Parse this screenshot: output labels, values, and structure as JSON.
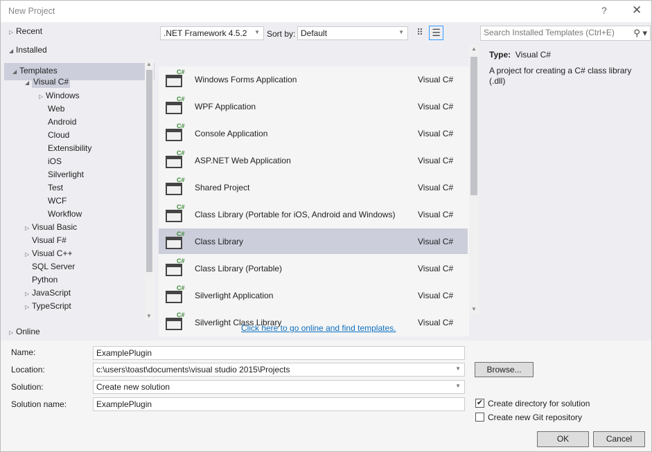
{
  "window": {
    "title": "New Project",
    "help": "?",
    "close": "✕"
  },
  "left": {
    "recent": "Recent",
    "installed": "Installed",
    "templates": "Templates",
    "visual_csharp": "Visual C#",
    "csharp_children": [
      "Windows",
      "Web",
      "Android",
      "Cloud",
      "Extensibility",
      "iOS",
      "Silverlight",
      "Test",
      "WCF",
      "Workflow"
    ],
    "languages": [
      {
        "label": "Visual Basic",
        "expandable": true
      },
      {
        "label": "Visual F#",
        "expandable": false
      },
      {
        "label": "Visual C++",
        "expandable": true
      },
      {
        "label": "SQL Server",
        "expandable": false
      },
      {
        "label": "Python",
        "expandable": false
      },
      {
        "label": "JavaScript",
        "expandable": true
      },
      {
        "label": "TypeScript",
        "expandable": true
      }
    ],
    "online": "Online"
  },
  "toolbar": {
    "framework": ".NET Framework 4.5.2",
    "sort_label": "Sort by:",
    "sort_value": "Default",
    "search_placeholder": "Search Installed Templates (Ctrl+E)"
  },
  "templates": [
    {
      "name": "Windows Forms Application",
      "lang": "Visual C#",
      "icon": "winforms-icon"
    },
    {
      "name": "WPF Application",
      "lang": "Visual C#",
      "icon": "wpf-icon"
    },
    {
      "name": "Console Application",
      "lang": "Visual C#",
      "icon": "console-icon"
    },
    {
      "name": "ASP.NET Web Application",
      "lang": "Visual C#",
      "icon": "web-icon"
    },
    {
      "name": "Shared Project",
      "lang": "Visual C#",
      "icon": "shared-project-icon"
    },
    {
      "name": "Class Library (Portable for iOS, Android and Windows)",
      "lang": "Visual C#",
      "icon": "class-library-icon"
    },
    {
      "name": "Class Library",
      "lang": "Visual C#",
      "icon": "class-library-icon",
      "selected": true
    },
    {
      "name": "Class Library (Portable)",
      "lang": "Visual C#",
      "icon": "class-library-icon"
    },
    {
      "name": "Silverlight Application",
      "lang": "Visual C#",
      "icon": "silverlight-icon"
    },
    {
      "name": "Silverlight Class Library",
      "lang": "Visual C#",
      "icon": "silverlight-library-icon"
    }
  ],
  "online_link": "Click here to go online and find templates.",
  "details": {
    "type_label": "Type:",
    "type_value": "Visual C#",
    "description": "A project for creating a C# class library (.dll)"
  },
  "form": {
    "name_label": "Name:",
    "name_value": "ExamplePlugin",
    "location_label": "Location:",
    "location_value": "c:\\users\\toast\\documents\\visual studio 2015\\Projects",
    "solution_label": "Solution:",
    "solution_value": "Create new solution",
    "solution_name_label": "Solution name:",
    "solution_name_value": "ExamplePlugin",
    "browse": "Browse...",
    "create_dir": "Create directory for solution",
    "create_dir_checked": true,
    "git": "Create new Git repository",
    "git_checked": false,
    "ok": "OK",
    "cancel": "Cancel"
  },
  "colors": {
    "selection": "#cccedb",
    "link": "#0e70c0",
    "csharp_badge": "#388a34"
  }
}
